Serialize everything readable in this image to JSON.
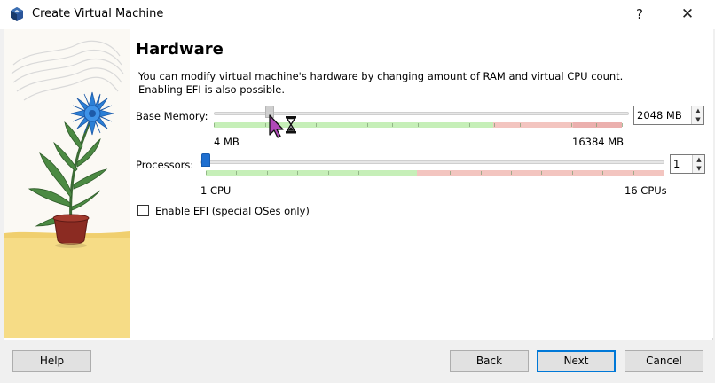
{
  "window": {
    "title": "Create Virtual Machine",
    "help_glyph": "?",
    "close_glyph": "✕"
  },
  "page": {
    "heading": "Hardware",
    "description_line1": "You can modify virtual machine's hardware by changing amount of RAM and virtual CPU count.",
    "description_line2": "Enabling EFI is also possible."
  },
  "memory": {
    "label": "Base Memory:",
    "value": "2048 MB",
    "min_label": "4 MB",
    "max_label": "16384 MB",
    "value_mb": 2048,
    "min_mb": 4,
    "max_mb": 16384
  },
  "processors": {
    "label": "Processors:",
    "value": "1",
    "min_label": "1 CPU",
    "max_label": "16 CPUs",
    "count": 1,
    "min": 1,
    "max": 16
  },
  "efi": {
    "label": "Enable EFI (special OSes only)",
    "checked": false
  },
  "buttons": {
    "help": "Help",
    "back": "Back",
    "next": "Next",
    "cancel": "Cancel"
  },
  "colors": {
    "accent": "#0078d7",
    "slider_thumb_blue": "#1f6fd0",
    "scale_green": "#c6efb8",
    "scale_red": "#f3c5c0",
    "illustration_yellow": "#f6dc86",
    "flower_blue": "#2b7fd6"
  },
  "icons": [
    "virtualbox-icon",
    "help-icon",
    "close-icon",
    "hourglass-cursor-icon"
  ]
}
